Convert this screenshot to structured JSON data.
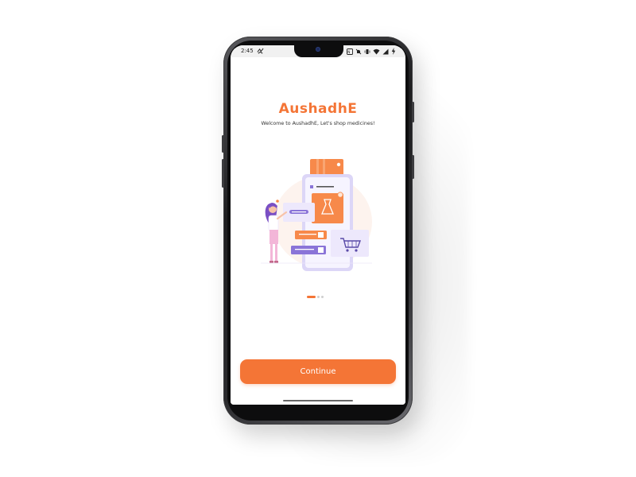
{
  "status_bar": {
    "time": "2:45",
    "left_icon": "notification-icon",
    "right_icons": [
      "nfc-icon",
      "mute-icon",
      "vibrate-icon",
      "wifi-icon",
      "signal-icon",
      "battery-charging-icon"
    ]
  },
  "onboarding": {
    "title": "AushadhE",
    "subtitle": "Welcome to AushadhE, Let's shop medicines!",
    "illustration": "online-shopping-illustration",
    "pager": {
      "total_pages": 3,
      "current_page": 1
    },
    "continue_label": "Continue"
  },
  "colors": {
    "accent": "#f47536",
    "title": "#f47536",
    "button_text": "#ffffff",
    "illustration_purple": "#8a74d8",
    "illustration_lavender": "#e9e3fb"
  }
}
